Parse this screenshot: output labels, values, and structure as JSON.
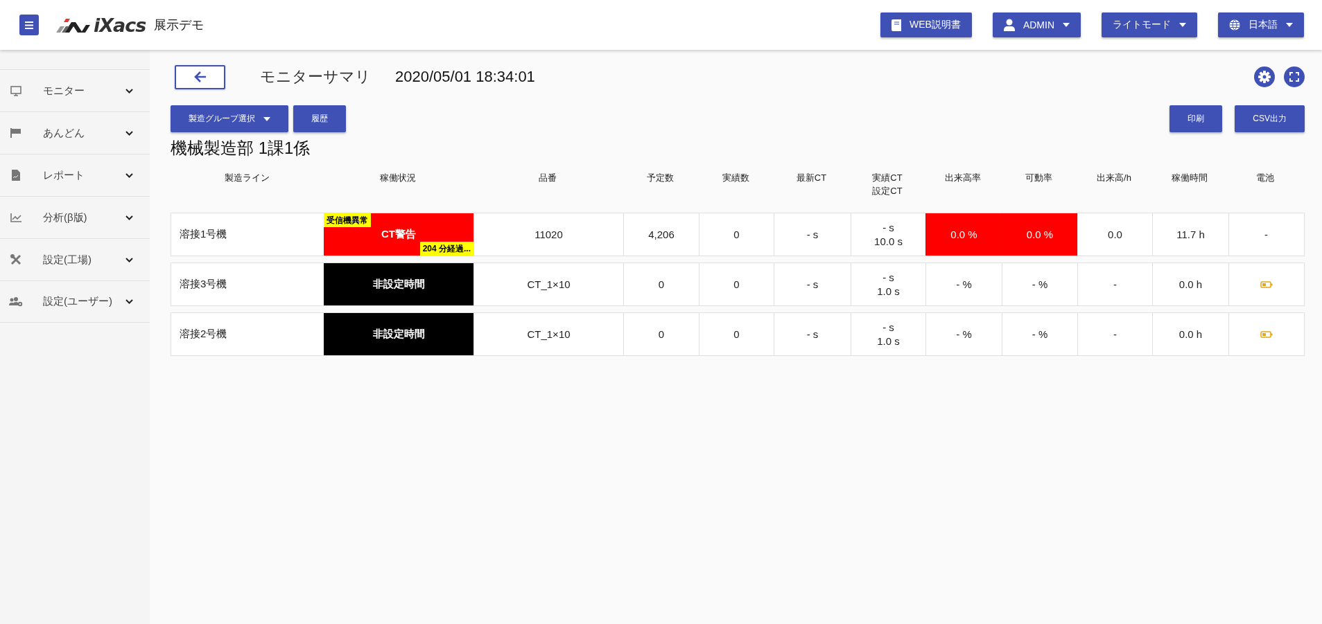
{
  "header": {
    "logo": "iXacs",
    "site_name": "展示デモ",
    "buttons": [
      {
        "kind": "manual",
        "label": "WEB説明書",
        "dropdown": false
      },
      {
        "kind": "user",
        "label": "ADMIN",
        "dropdown": true
      },
      {
        "kind": "theme",
        "label": "ライトモード",
        "dropdown": true
      },
      {
        "kind": "language",
        "label": "日本語",
        "dropdown": true
      }
    ]
  },
  "sidebar": {
    "items": [
      {
        "kind": "monitor",
        "label": "モニター",
        "expanded": false
      },
      {
        "kind": "flag",
        "label": "あんどん",
        "expanded": false
      },
      {
        "kind": "report",
        "label": "レポート",
        "expanded": false
      },
      {
        "kind": "chart",
        "label": "分析(β版)",
        "expanded": false
      },
      {
        "kind": "tools",
        "label": "設定(工場)",
        "expanded": false
      },
      {
        "kind": "users",
        "label": "設定(ユーザー)",
        "expanded": false
      }
    ]
  },
  "page": {
    "title": "モニターサマリ",
    "datetime": "2020/05/01 18:34:01",
    "left_buttons": [
      {
        "label": "製造グループ選択",
        "dropdown": true
      },
      {
        "label": "履歴",
        "dropdown": false
      }
    ],
    "right_buttons": [
      {
        "label": "印刷"
      },
      {
        "label": "CSV出力"
      }
    ],
    "group_heading": "機械製造部 1課1係"
  },
  "table": {
    "columns": [
      "製造ライン",
      "稼働状況",
      "品番",
      "予定数",
      "実績数",
      "最新CT",
      "実績CT\n設定CT",
      "出来高率",
      "可動率",
      "出来高/h",
      "稼働時間",
      "電池"
    ],
    "rows": [
      {
        "line": "溶接1号機",
        "status": {
          "kind": "alert",
          "label": "CT警告",
          "top_badge": "受信機異常",
          "bottom_badge": "204 分経過..."
        },
        "part": "11020",
        "planned": "4,206",
        "actual": "0",
        "latest_ct": "- s",
        "actual_ct": "- s",
        "set_ct": "10.0 s",
        "yield_rate": {
          "text": "0.0 %",
          "alert": true
        },
        "availability": {
          "text": "0.0 %",
          "alert": true
        },
        "output_per_hour": "0.0",
        "run_time": "11.7 h",
        "battery": {
          "kind": "text",
          "text": "-"
        }
      },
      {
        "line": "溶接3号機",
        "status": {
          "kind": "off",
          "label": "非設定時間"
        },
        "part": "CT_1×10",
        "planned": "0",
        "actual": "0",
        "latest_ct": "- s",
        "actual_ct": "- s",
        "set_ct": "1.0 s",
        "yield_rate": {
          "text": "- %",
          "alert": false
        },
        "availability": {
          "text": "- %",
          "alert": false
        },
        "output_per_hour": "-",
        "run_time": "0.0 h",
        "battery": {
          "kind": "icon"
        }
      },
      {
        "line": "溶接2号機",
        "status": {
          "kind": "off",
          "label": "非設定時間"
        },
        "part": "CT_1×10",
        "planned": "0",
        "actual": "0",
        "latest_ct": "- s",
        "actual_ct": "- s",
        "set_ct": "1.0 s",
        "yield_rate": {
          "text": "- %",
          "alert": false
        },
        "availability": {
          "text": "- %",
          "alert": false
        },
        "output_per_hour": "-",
        "run_time": "0.0 h",
        "battery": {
          "kind": "icon"
        }
      }
    ]
  }
}
